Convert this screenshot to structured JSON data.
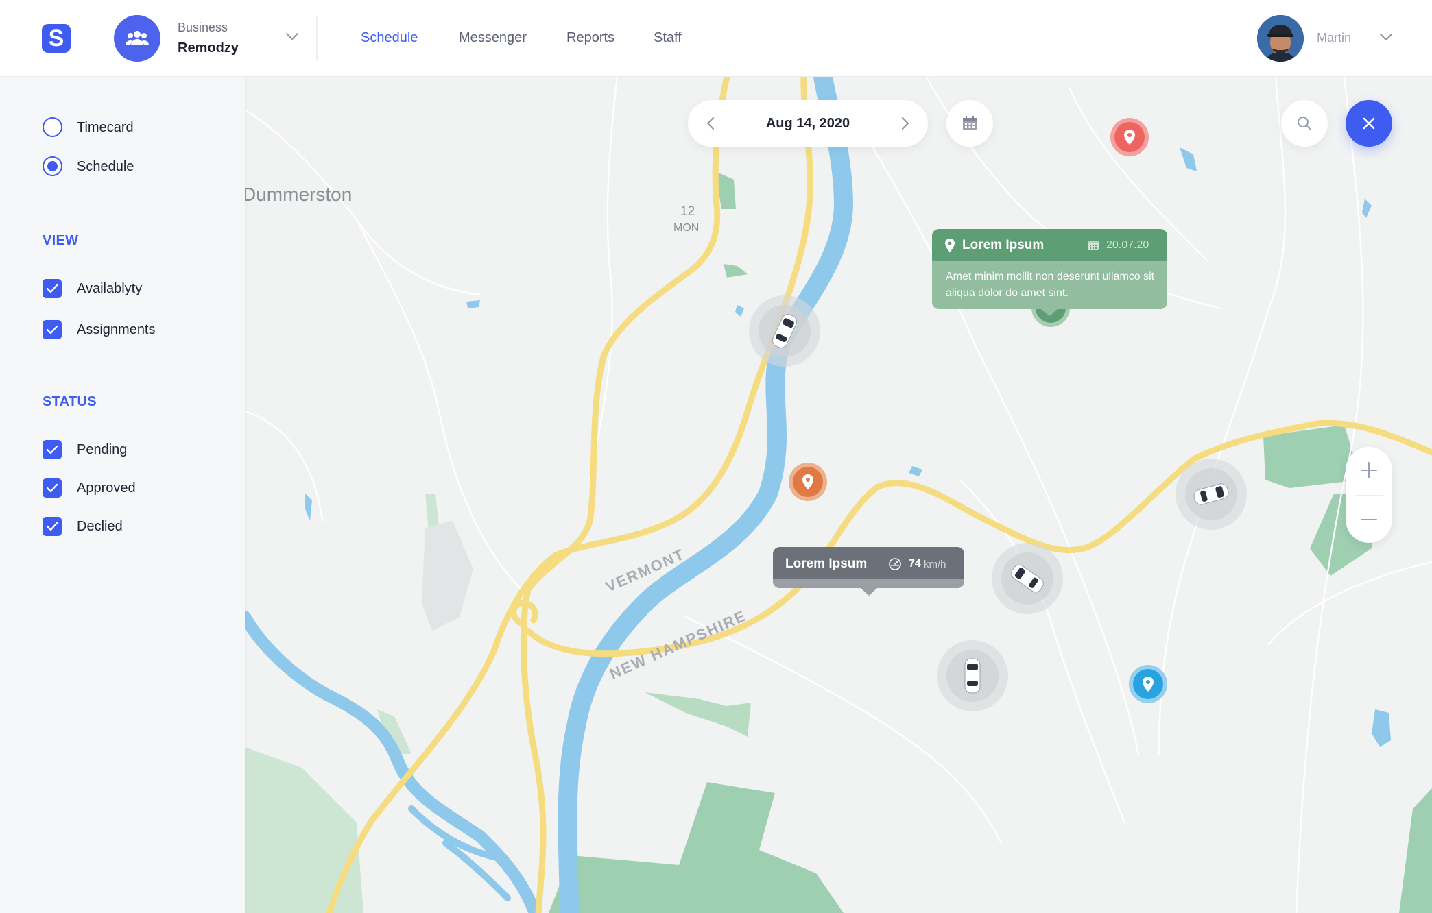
{
  "header": {
    "business_label": "Business",
    "business_name": "Remodzy",
    "nav": [
      "Schedule",
      "Messenger",
      "Reports",
      "Staff"
    ],
    "active_nav": "Schedule",
    "user_name": "Martin"
  },
  "sidebar": {
    "mode_options": [
      {
        "label": "Timecard",
        "checked": false
      },
      {
        "label": "Schedule",
        "checked": true
      }
    ],
    "view_title": "VIEW",
    "view_options": [
      {
        "label": "Availablyty",
        "checked": true
      },
      {
        "label": "Assignments",
        "checked": true
      }
    ],
    "status_title": "STATUS",
    "status_options": [
      {
        "label": "Pending",
        "checked": true
      },
      {
        "label": "Approved",
        "checked": true
      },
      {
        "label": "Declied",
        "checked": true
      }
    ]
  },
  "map": {
    "date": "Aug 14, 2020",
    "places": {
      "town": "Dummerston",
      "route_num": "12",
      "route_sub": "MON",
      "state1": "VERMONT",
      "state2": "NEW HAMPSHIRE"
    },
    "tooltip_place": {
      "title": "Lorem Ipsum",
      "date": "20.07.20",
      "body": "Amet minim mollit non deserunt ullamco  sit aliqua dolor do amet sint."
    },
    "tooltip_vehicle": {
      "title": "Lorem Ipsum",
      "speed": "74",
      "unit": "km/h"
    }
  },
  "colors": {
    "accent": "#3f5cf0",
    "pin_red": "#ee6461",
    "pin_orange": "#e07a44",
    "pin_green": "#5d9e74",
    "pin_blue": "#29a3df",
    "water": "#8ec9ec",
    "road": "#f6dc80",
    "park": "#9ecfb0"
  }
}
